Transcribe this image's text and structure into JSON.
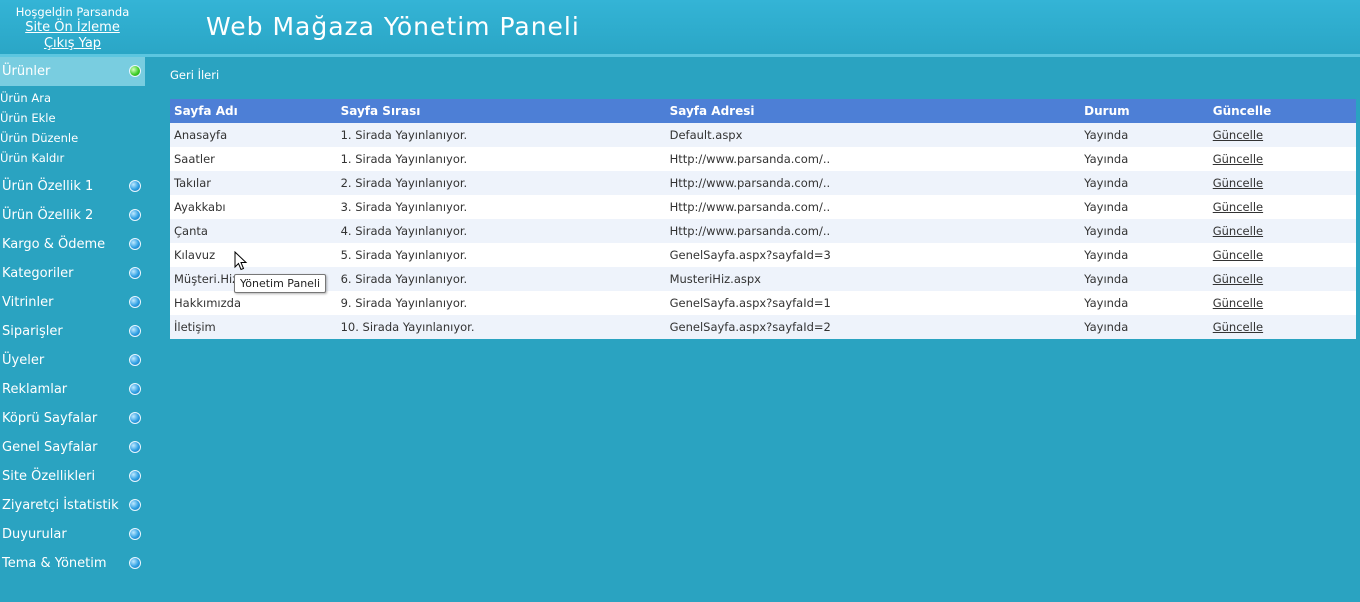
{
  "header": {
    "welcome": "Hoşgeldin Parsanda",
    "preview_link": "Site Ön İzleme",
    "logout_link": "Çıkış Yap",
    "title": "Web Mağaza Yönetim Paneli"
  },
  "sidebar": {
    "active_section": {
      "label": "Ürünler",
      "sub_items": [
        "Ürün Ara",
        "Ürün Ekle",
        "Ürün Düzenle",
        "Ürün Kaldır"
      ]
    },
    "sections": [
      "Ürün Özellik 1",
      "Ürün Özellik 2",
      "Kargo & Ödeme",
      "Kategoriler",
      "Vitrinler",
      "Siparişler",
      "Üyeler",
      "Reklamlar",
      "Köprü Sayfalar",
      "Genel Sayfalar",
      "Site Özellikleri",
      "Ziyaretçi İstatistik",
      "Duyurular",
      "Tema & Yönetim"
    ]
  },
  "nav": {
    "back": "Geri",
    "forward": "İleri"
  },
  "table": {
    "columns": [
      "Sayfa Adı",
      "Sayfa Sırası",
      "Sayfa Adresi",
      "Durum",
      "Güncelle"
    ],
    "rows": [
      [
        "Anasayfa",
        "1. Sirada Yayınlanıyor.",
        "Default.aspx",
        "Yayında",
        "Güncelle"
      ],
      [
        "Saatler",
        "1. Sirada Yayınlanıyor.",
        "Http://www.parsanda.com/..",
        "Yayında",
        "Güncelle"
      ],
      [
        "Takılar",
        "2. Sirada Yayınlanıyor.",
        "Http://www.parsanda.com/..",
        "Yayında",
        "Güncelle"
      ],
      [
        "Ayakkabı",
        "3. Sirada Yayınlanıyor.",
        "Http://www.parsanda.com/..",
        "Yayında",
        "Güncelle"
      ],
      [
        "Çanta",
        "4. Sirada Yayınlanıyor.",
        "Http://www.parsanda.com/..",
        "Yayında",
        "Güncelle"
      ],
      [
        "Kılavuz",
        "5. Sirada Yayınlanıyor.",
        "GenelSayfa.aspx?sayfaId=3",
        "Yayında",
        "Güncelle"
      ],
      [
        "Müşteri.Hiz",
        "6. Sirada Yayınlanıyor.",
        "MusteriHiz.aspx",
        "Yayında",
        "Güncelle"
      ],
      [
        "Hakkımızda",
        "9. Sirada Yayınlanıyor.",
        "GenelSayfa.aspx?sayfaId=1",
        "Yayında",
        "Güncelle"
      ],
      [
        "İletişim",
        "10. Sirada Yayınlanıyor.",
        "GenelSayfa.aspx?sayfaId=2",
        "Yayında",
        "Güncelle"
      ]
    ]
  },
  "tooltip": "Yönetim Paneli",
  "colors": {
    "background": "#2aa3c1",
    "header_bg": "#34b4d6",
    "active_menu": "#79cde0",
    "table_header": "#4d7fd6",
    "row_alt": "#eef3fb",
    "dot_active": "green-circle-icon",
    "dot_inactive": "blue-circle-icon"
  }
}
